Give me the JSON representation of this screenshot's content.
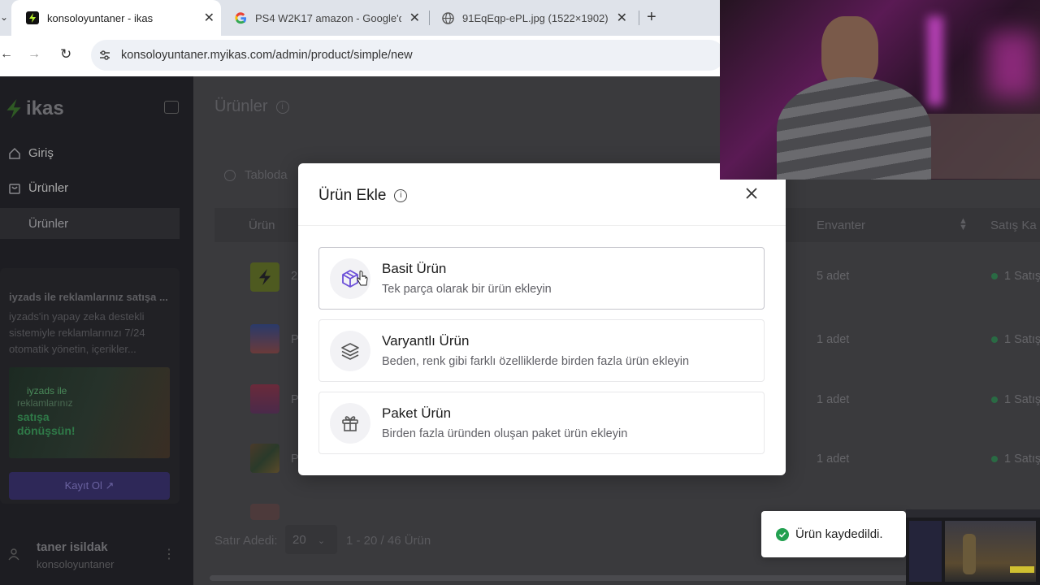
{
  "browser": {
    "tabs": [
      {
        "title": "konsoloyuntaner - ikas",
        "active": true
      },
      {
        "title": "PS4 W2K17 amazon - Google'd",
        "active": false
      },
      {
        "title": "91EqEqp-ePL.jpg (1522×1902)",
        "active": false
      }
    ],
    "url": "konsoloyuntaner.myikas.com/admin/product/simple/new"
  },
  "sidebar": {
    "logo": "ikas",
    "items": [
      {
        "label": "Giriş"
      },
      {
        "label": "Ürünler"
      },
      {
        "label": "Ürünler"
      }
    ],
    "promo": {
      "title": "iyzads ile reklamlarınız satışa ...",
      "body": "iyzads'in yapay zeka destekli sistemiyle reklamlarınızı 7/24 otomatik yönetin, içerikler...",
      "image_line1": "iyzads ile",
      "image_line2": "reklamlarınız",
      "image_line3": "satışa",
      "image_line4": "dönüşsün!",
      "button": "Kayıt Ol"
    },
    "user": {
      "name": "taner isildak",
      "store": "konsoloyuntaner"
    }
  },
  "main": {
    "title": "Ürünler",
    "search_placeholder": "Tabloda",
    "columns": {
      "product": "Ürün",
      "inventory": "Envanter",
      "sales": "Satış Ka"
    },
    "rows": [
      {
        "name": "2",
        "inventory": "5 adet",
        "sales": "1 Satış"
      },
      {
        "name": "P",
        "inventory": "1 adet",
        "sales": "1 Satış"
      },
      {
        "name": "P",
        "inventory": "1 adet",
        "sales": "1 Satış"
      },
      {
        "name": "P",
        "inventory": "1 adet",
        "sales": "1 Satış"
      }
    ],
    "footer": {
      "rows_label": "Satır Adedi:",
      "rows_value": "20",
      "range": "1 - 20 / 46 Ürün"
    }
  },
  "modal": {
    "title": "Ürün Ekle",
    "options": [
      {
        "title": "Basit Ürün",
        "desc": "Tek parça olarak bir ürün ekleyin",
        "icon": "box-icon"
      },
      {
        "title": "Varyantlı Ürün",
        "desc": "Beden, renk gibi farklı özelliklerde birden fazla ürün ekleyin",
        "icon": "layers-icon"
      },
      {
        "title": "Paket Ürün",
        "desc": "Birden fazla üründen oluşan paket ürün ekleyin",
        "icon": "gift-icon"
      }
    ]
  },
  "toast": {
    "message": "Ürün kaydedildi."
  },
  "colors": {
    "accent": "#6b4fd8",
    "success": "#22a050",
    "overlay_bg": "#3a3a3d"
  }
}
